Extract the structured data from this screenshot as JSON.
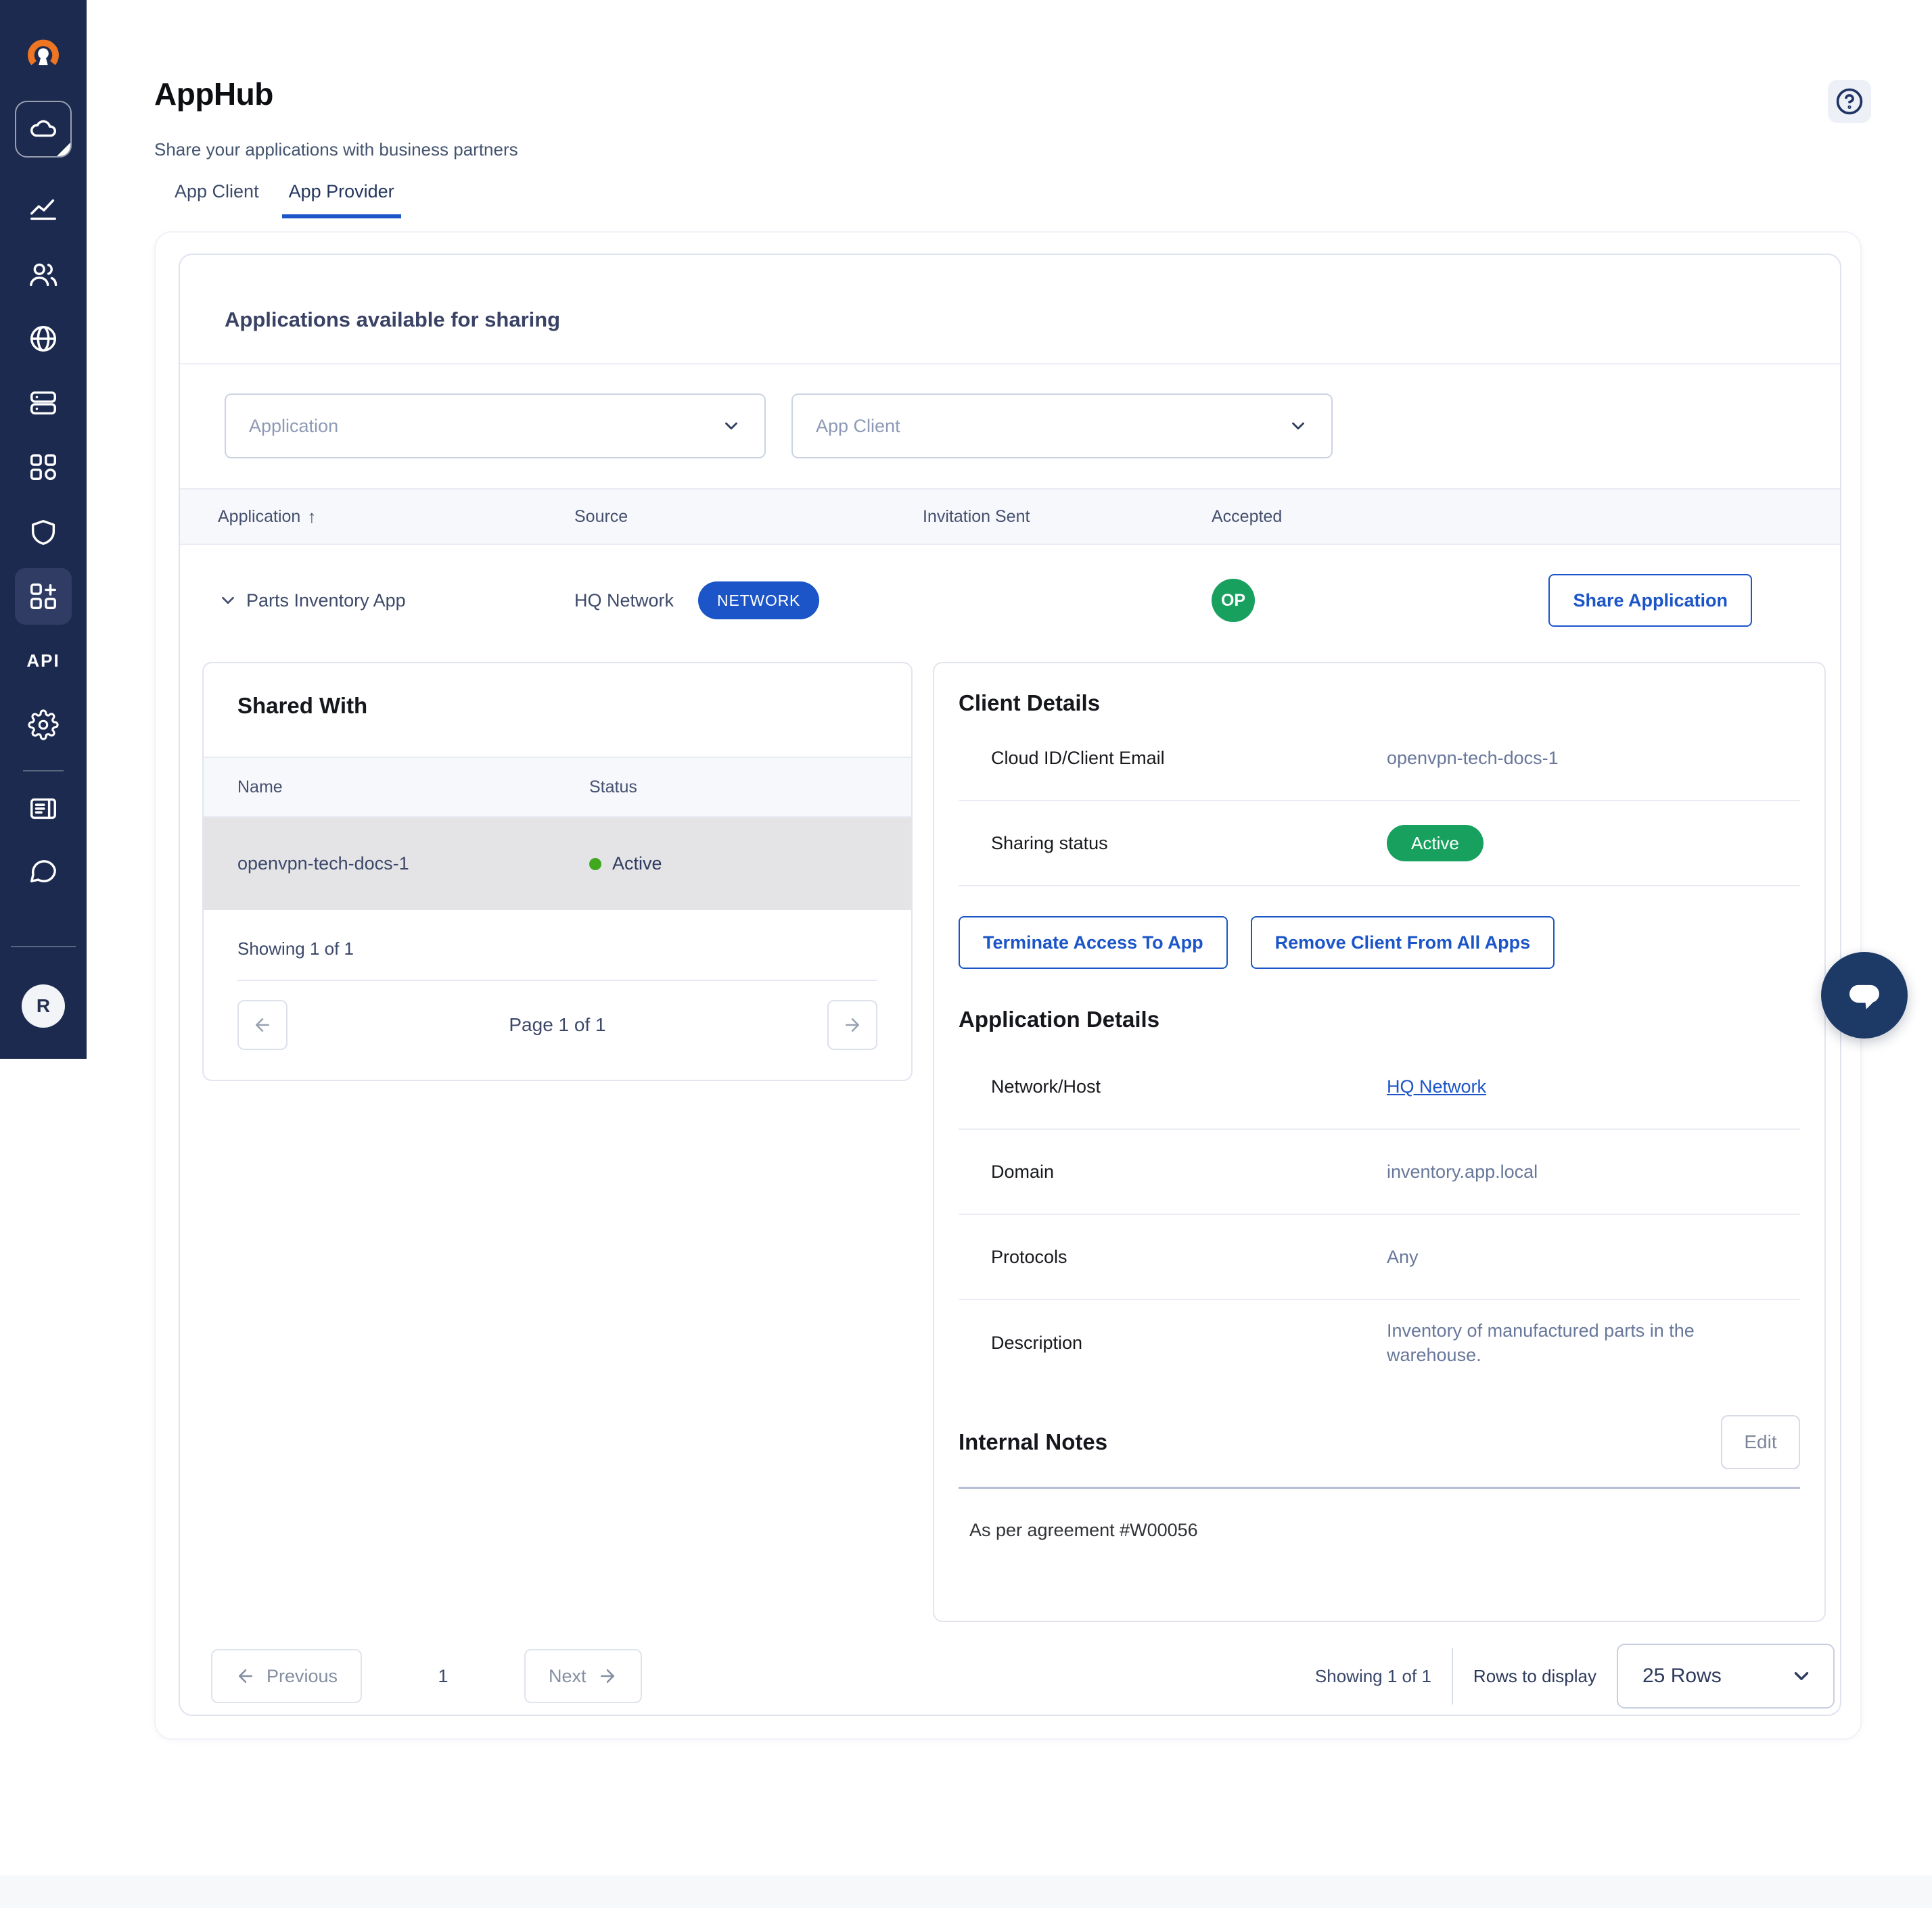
{
  "colors": {
    "accent_blue": "#1B55C8",
    "status_green": "#18A05F",
    "dot_green": "#3FA81F",
    "sidebar_navy": "#1D2A4F",
    "text_dark": "#15171C",
    "text_muted": "#68779A"
  },
  "sidebar": {
    "items": [
      "openvpn-logo",
      "cloud",
      "chart",
      "users",
      "globe",
      "server",
      "apps-grid",
      "shield",
      "apphub-selected",
      "api",
      "settings-gear",
      "news",
      "chat"
    ],
    "api_label": "API",
    "avatar_initial": "R"
  },
  "header": {
    "title": "AppHub",
    "subtitle": "Share your applications with business partners",
    "help_icon": "question-circle"
  },
  "tabs": [
    {
      "label": "App Client",
      "active": false
    },
    {
      "label": "App Provider",
      "active": true
    }
  ],
  "sharing_card": {
    "title": "Applications available for sharing",
    "filters": {
      "application_placeholder": "Application",
      "app_client_placeholder": "App Client"
    },
    "table": {
      "columns": [
        "Application",
        "Source",
        "Invitation Sent",
        "Accepted"
      ],
      "sort_icon": "arrow-up",
      "row": {
        "application": "Parts Inventory App",
        "expanded": true,
        "source": "HQ Network",
        "source_badge": "NETWORK",
        "invitation_sent": "",
        "accepted_badge": "OP",
        "share_button": "Share Application"
      }
    }
  },
  "shared_with": {
    "title": "Shared With",
    "columns": [
      "Name",
      "Status"
    ],
    "rows": [
      {
        "name": "openvpn-tech-docs-1",
        "status": "Active"
      }
    ],
    "summary": "Showing 1 of 1",
    "pagination": "Page 1 of 1"
  },
  "client_details": {
    "title": "Client Details",
    "fields": [
      {
        "label": "Cloud ID/Client Email",
        "value": "openvpn-tech-docs-1"
      },
      {
        "label": "Sharing status",
        "value": "Active"
      }
    ],
    "actions": [
      "Terminate Access To App",
      "Remove Client From All Apps"
    ],
    "application_details": {
      "title": "Application Details",
      "fields": [
        {
          "label": "Network/Host",
          "value": "HQ Network"
        },
        {
          "label": "Domain",
          "value": "inventory.app.local"
        },
        {
          "label": "Protocols",
          "value": "Any"
        },
        {
          "label": "Description",
          "value": "Inventory of manufactured parts in the warehouse."
        }
      ]
    },
    "internal_notes": {
      "title": "Internal Notes",
      "edit_button": "Edit",
      "note": "As per agreement #W00056"
    }
  },
  "footer": {
    "previous": "Previous",
    "page": "1",
    "next": "Next",
    "showing": "Showing 1 of 1",
    "rows_label": "Rows to display",
    "rows_value": "25 Rows"
  }
}
